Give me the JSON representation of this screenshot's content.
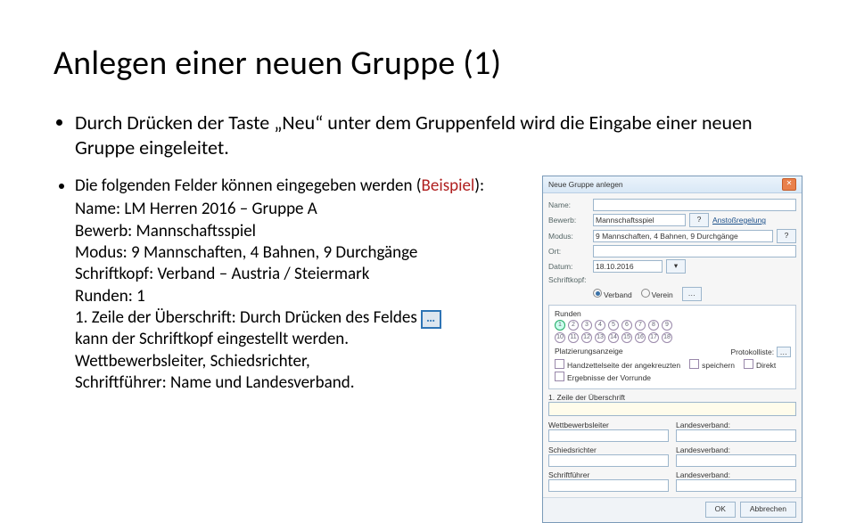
{
  "title": "Anlegen einer neuen Gruppe (1)",
  "bullet1": "Durch Drücken der Taste „Neu“ unter dem Gruppenfeld wird die Eingabe einer neuen Gruppe eingeleitet.",
  "bullet2_intro": "Die folgenden Felder können eingegeben werden (",
  "bullet2_example": "Beispiel",
  "bullet2_intro_end": "):",
  "fields": {
    "name": "Name: LM Herren 2016 – Gruppe A",
    "bewerb": "Bewerb: Mannschaftsspiel",
    "modus": "Modus: 9 Mannschaften, 4 Bahnen, 9 Durchgänge",
    "schriftkopf": "Schriftkopf: Verband – Austria / Steiermark",
    "runden": "Runden: 1",
    "zeile1a": "1. Zeile der Überschrift: Durch Drücken des Feldes",
    "zeile1b": "kann der Schriftkopf eingestellt werden.",
    "rest1": "Wettbewerbsleiter, Schiedsrichter,",
    "rest2": "Schriftführer: Name und Landesverband."
  },
  "ellipsis": "…",
  "dialog": {
    "title": "Neue Gruppe anlegen",
    "labels": {
      "name": "Name:",
      "bewerb": "Bewerb:",
      "modus": "Modus:",
      "runden": "Runden",
      "ort": "Ort:",
      "datum": "Datum:",
      "schriftkopf": "Schriftkopf:",
      "verband": "Verband",
      "verein": "Verein",
      "platzierung": "Platzierungsanzeige",
      "protokolliste": "Protokolliste:",
      "handzettel": "Handzettelseite der angekreuzten",
      "ergebnisse": "Ergebnisse der Vorrunde",
      "spieler": "speichern",
      "direkt": "Direkt",
      "zeile1": "1. Zeile der Überschrift",
      "wettbewerb": "Wettbewerbsleiter",
      "landverb1": "Landesverband:",
      "schieds": "Schiedsrichter",
      "landverb2": "Landesverband:",
      "schriftf": "Schriftführer",
      "landverb3": "Landesverband:"
    },
    "bewerb_value": "Mannschaftsspiel",
    "modus_value": "9 Mannschaften, 4 Bahnen, 9 Durchgänge",
    "datum_value": "18.10.2016",
    "link": "Anstoßregelung",
    "btn_q": "?",
    "btn_dots": "…",
    "btn_ok": "OK",
    "btn_cancel": "Abbrechen"
  }
}
